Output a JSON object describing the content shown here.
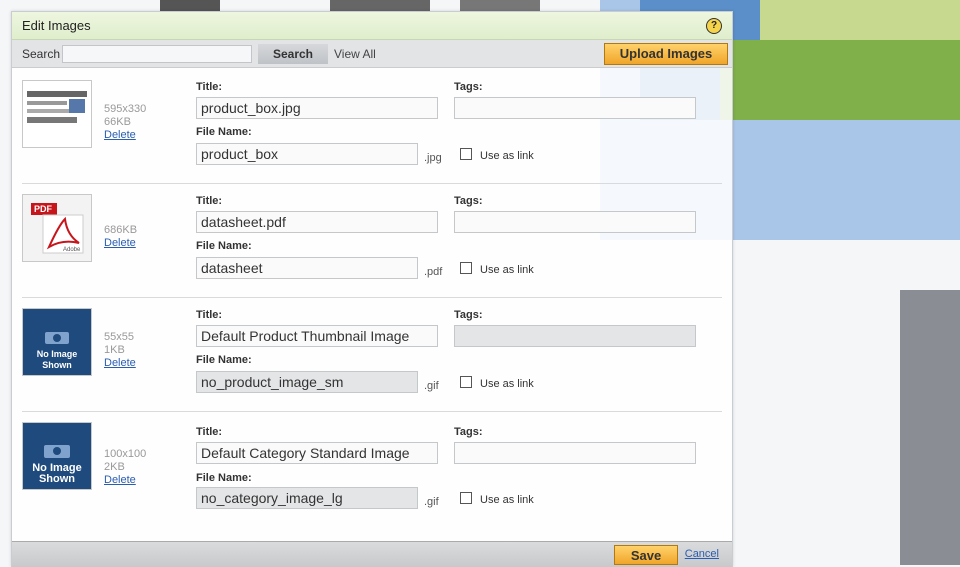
{
  "dialog": {
    "title": "Edit Images"
  },
  "search": {
    "label": "Search",
    "value": "",
    "button": "Search",
    "view_all": "View All",
    "upload": "Upload Images"
  },
  "labels": {
    "title": "Title:",
    "tags": "Tags:",
    "file_name": "File Name:",
    "use_as_link": "Use as link",
    "delete": "Delete"
  },
  "images": [
    {
      "dims": "595x330",
      "size": "66KB",
      "title": "product_box.jpg",
      "file_name": "product_box",
      "ext": ".jpg",
      "tags": "",
      "thumb": "screenshot-thumbnail"
    },
    {
      "dims": "",
      "size": "686KB",
      "title": "datasheet.pdf",
      "file_name": "datasheet",
      "ext": ".pdf",
      "tags": "",
      "thumb": "pdf-icon",
      "thumb_text": "PDF",
      "thumb_sub": "Adobe"
    },
    {
      "dims": "55x55",
      "size": "1KB",
      "title": "Default Product Thumbnail Image",
      "file_name": "no_product_image_sm",
      "ext": ".gif",
      "tags": "",
      "thumb": "no-image-icon",
      "thumb_text": "No Image Shown"
    },
    {
      "dims": "100x100",
      "size": "2KB",
      "title": "Default Category Standard Image",
      "file_name": "no_category_image_lg",
      "ext": ".gif",
      "tags": "",
      "thumb": "no-image-icon",
      "thumb_text": "No Image Shown"
    }
  ],
  "footer": {
    "save": "Save",
    "cancel": "Cancel"
  },
  "colors": {
    "accent": "#f0a52a",
    "header": "#dfeecd",
    "link": "#2a5db0",
    "thumb_blue": "#1f4a7e"
  }
}
